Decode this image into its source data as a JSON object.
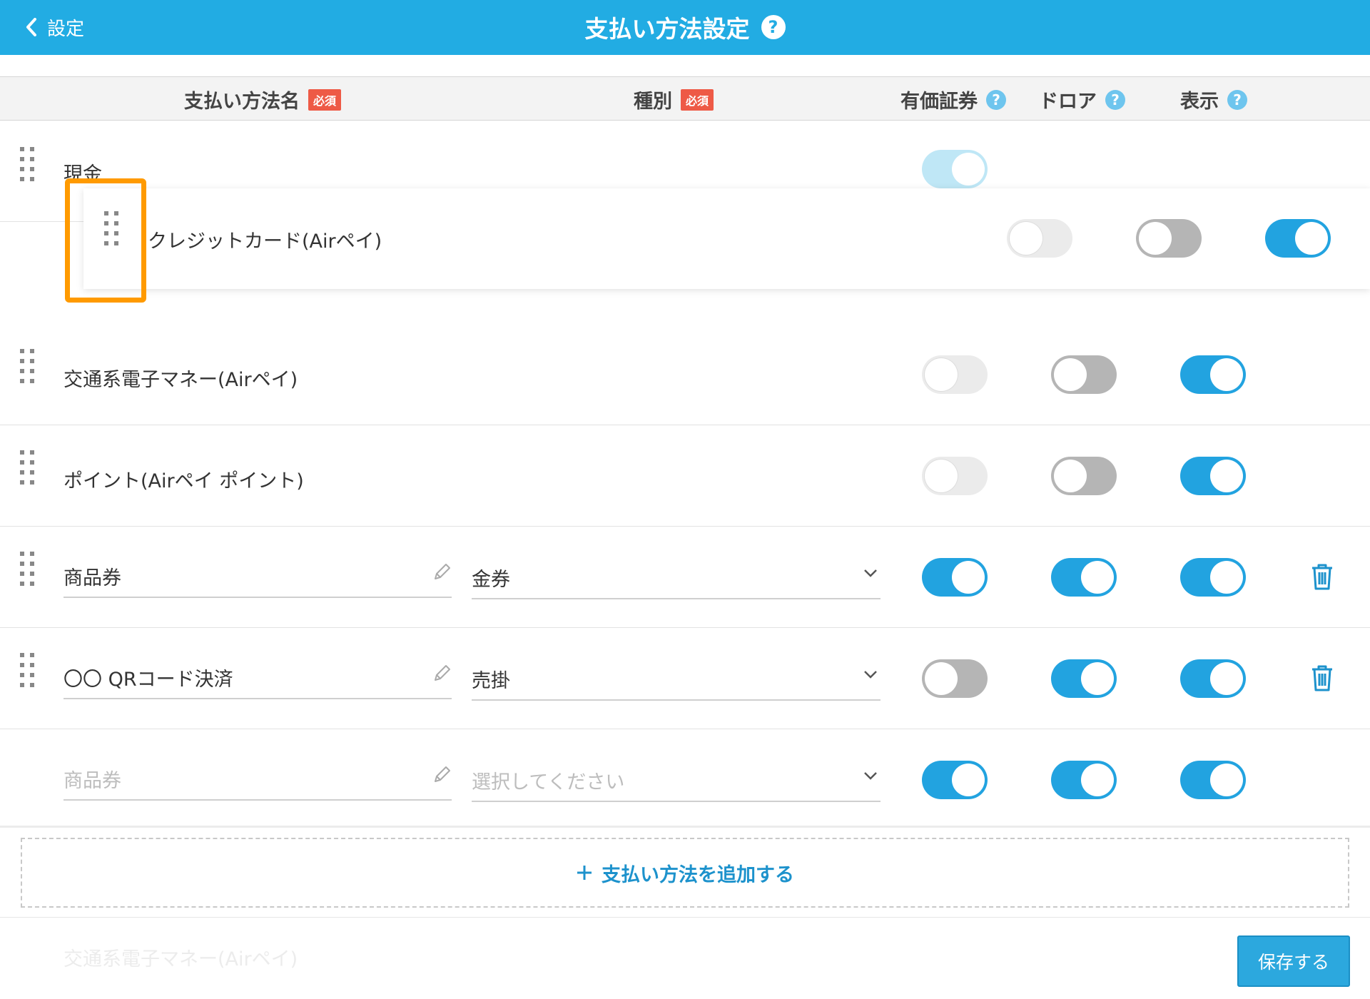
{
  "header": {
    "back_label": "設定",
    "title": "支払い方法設定"
  },
  "columns": {
    "name": "支払い方法名",
    "type": "種別",
    "required": "必須",
    "securities": "有価証券",
    "drawer": "ドロア",
    "display": "表示"
  },
  "rows": [
    {
      "name": "現金",
      "securities": "on-faded"
    },
    {
      "name": "クレジットカード(Airペイ)",
      "securities": "off",
      "drawer": "off",
      "display": "on",
      "dragging": true
    },
    {
      "name": "交通系電子マネー(Airペイ)",
      "securities": "off",
      "drawer": "off",
      "display": "on"
    },
    {
      "name": "ポイント(Airペイ ポイント)",
      "securities": "off",
      "drawer": "off",
      "display": "on"
    },
    {
      "name": "商品券",
      "type": "金券",
      "securities": "on",
      "drawer": "on",
      "display": "on",
      "deletable": true
    },
    {
      "name": "〇〇 QRコード決済",
      "type": "売掛",
      "securities": "off",
      "drawer": "on",
      "display": "on",
      "deletable": true
    },
    {
      "name_placeholder": "商品券",
      "type_placeholder": "選択してください",
      "securities": "on",
      "drawer": "on",
      "display": "on"
    }
  ],
  "add_button": "支払い方法を追加する",
  "ghost_row": "交通系電子マネー(Airペイ)",
  "save_button": "保存する",
  "colors": {
    "accent": "#22ace3",
    "required_badge": "#ee5a46",
    "highlight": "#ff9a00"
  }
}
